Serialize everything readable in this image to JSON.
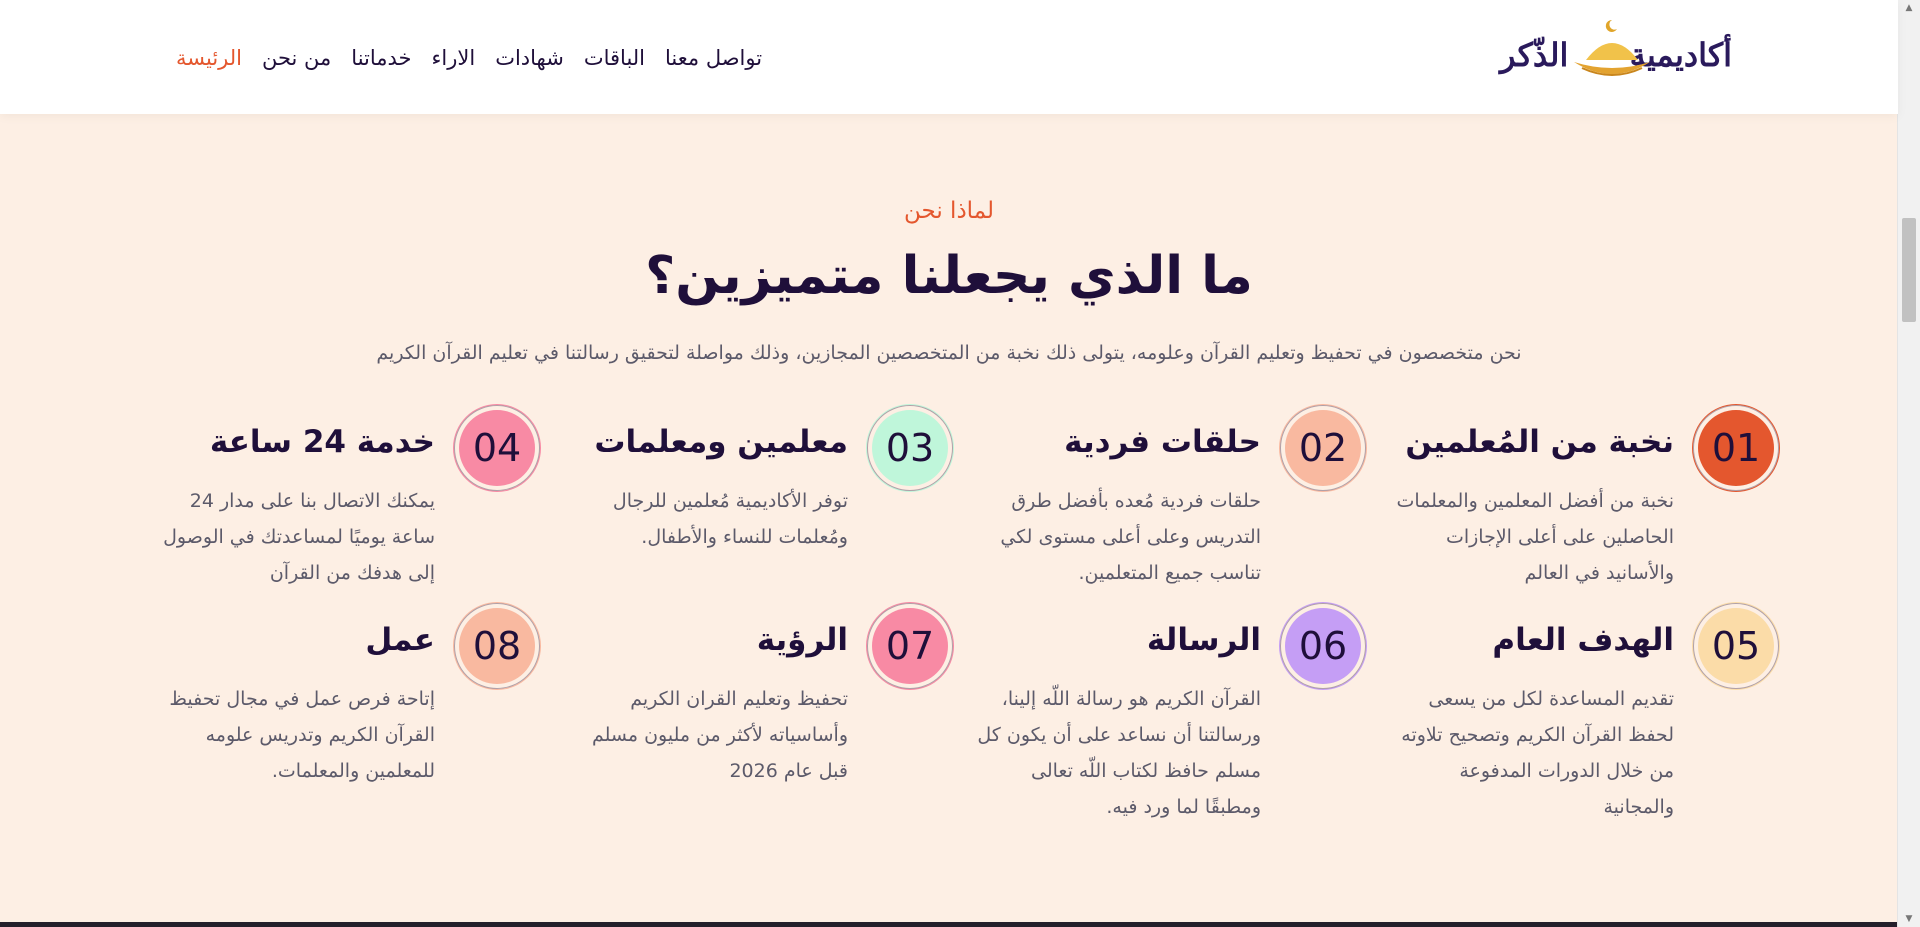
{
  "header": {
    "logo_text": "أكاديمية الذكر",
    "nav": [
      {
        "label": "الرئيسة",
        "active": true
      },
      {
        "label": "من نحن",
        "active": false
      },
      {
        "label": "خدماتنا",
        "active": false
      },
      {
        "label": "الاراء",
        "active": false
      },
      {
        "label": "شهادات",
        "active": false
      },
      {
        "label": "الباقات",
        "active": false
      },
      {
        "label": "تواصل معنا",
        "active": false
      }
    ]
  },
  "section": {
    "eyebrow": "لماذا نحن",
    "headline": "ما الذي يجعلنا متميزين؟",
    "lead": "نحن متخصصون في تحفيظ وتعليم القرآن وعلومه، يتولى ذلك نخبة من المتخصصين المجازين، وذلك مواصلة لتحقيق رسالتنا في تعليم القرآن الكريم",
    "features": [
      {
        "num": "01",
        "title": "نخبة من المُعلمين",
        "body": "نخبة من أفضل المعلمين والمعلمات الحاصلين على أعلى الإجازات والأسانيد في العالم",
        "color": "#e4572e"
      },
      {
        "num": "02",
        "title": "حلقات فردية",
        "body": "حلقات فردية مُعده بأفضل طرق التدريس وعلى أعلى مستوى لكي تناسب جميع المتعلمين.",
        "color": "#f9b9a0"
      },
      {
        "num": "03",
        "title": "معلمين ومعلمات",
        "body": "توفر الأكاديمية مُعلمين للرجال ومُعلمات للنساء والأطفال.",
        "color": "#bff6da"
      },
      {
        "num": "04",
        "title": "خدمة 24 ساعة",
        "body": "يمكنك الاتصال بنا على مدار 24 ساعة يوميًا لمساعدتك في الوصول إلى هدفك من القرآن",
        "color": "#f88aa4"
      },
      {
        "num": "05",
        "title": "الهدف العام",
        "body": "تقديم المساعدة لكل من يسعى لحفظ القرآن الكريم وتصحيح تلاوته من خلال الدورات المدفوعة والمجانية",
        "color": "#fbdca8"
      },
      {
        "num": "06",
        "title": "الرسالة",
        "body": "القرآن الكريم هو رسالة اللّه إلينا، ورسالتنا أن نساعد على أن يكون كل مسلم حافظ لكتاب اللّه تعالى ومطبقًا لما ورد فيه.",
        "color": "#c59ef5"
      },
      {
        "num": "07",
        "title": "الرؤية",
        "body": "تحفيظ وتعليم القران الكريم وأساسياته لأكثر من مليون مسلم قبل عام 2026",
        "color": "#f88aa4"
      },
      {
        "num": "08",
        "title": "عمل",
        "body": "إتاحة فرص عمل في مجال تحفيظ القرآن الكريم وتدريس علومه للمعلمين والمعلمات.",
        "color": "#f9b9a0"
      }
    ]
  }
}
